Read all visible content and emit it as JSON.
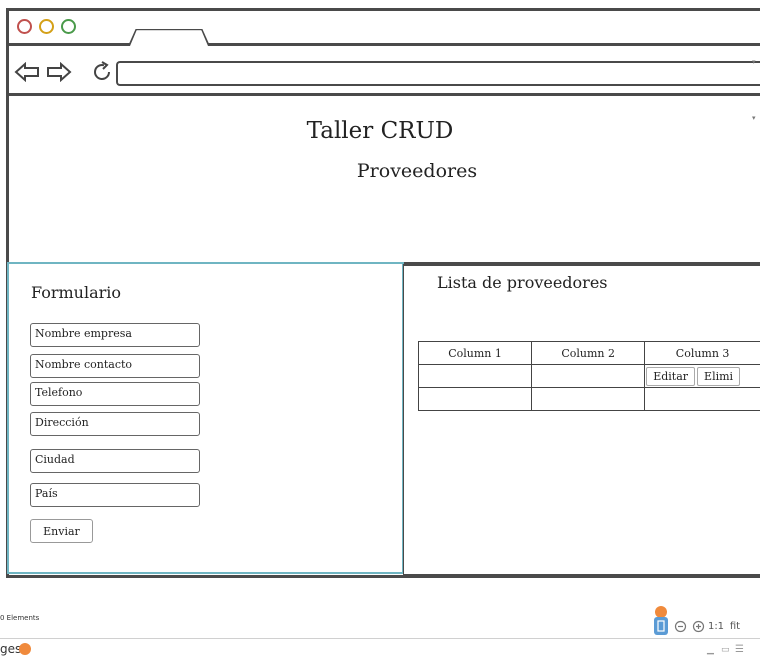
{
  "page": {
    "title": "Taller CRUD",
    "subtitle": "Proveedores"
  },
  "form": {
    "title": "Formulario",
    "fields": [
      {
        "placeholder": "Nombre empresa"
      },
      {
        "placeholder": "Nombre contacto"
      },
      {
        "placeholder": "Telefono"
      },
      {
        "placeholder": "Dirección"
      },
      {
        "placeholder": "Ciudad"
      },
      {
        "placeholder": "País"
      }
    ],
    "submit_label": "Enviar"
  },
  "list": {
    "title": "Lista de proveedores",
    "columns": [
      "Column 1",
      "Column 2",
      "Column 3"
    ],
    "row_actions": [
      "Editar",
      "Elimi"
    ]
  },
  "canvas_footer": {
    "elements_label": "0 Elements",
    "zoom_reset": "1:1",
    "zoom_fit": "fit"
  },
  "bottom_bar": {
    "pages_label": "ges"
  },
  "colors": {
    "accent_panel": "#6fb5c2",
    "traffic_red": "#c0504d",
    "traffic_yellow": "#d4a017",
    "traffic_green": "#4a9a4a",
    "marker_orange": "#f08a3c"
  }
}
